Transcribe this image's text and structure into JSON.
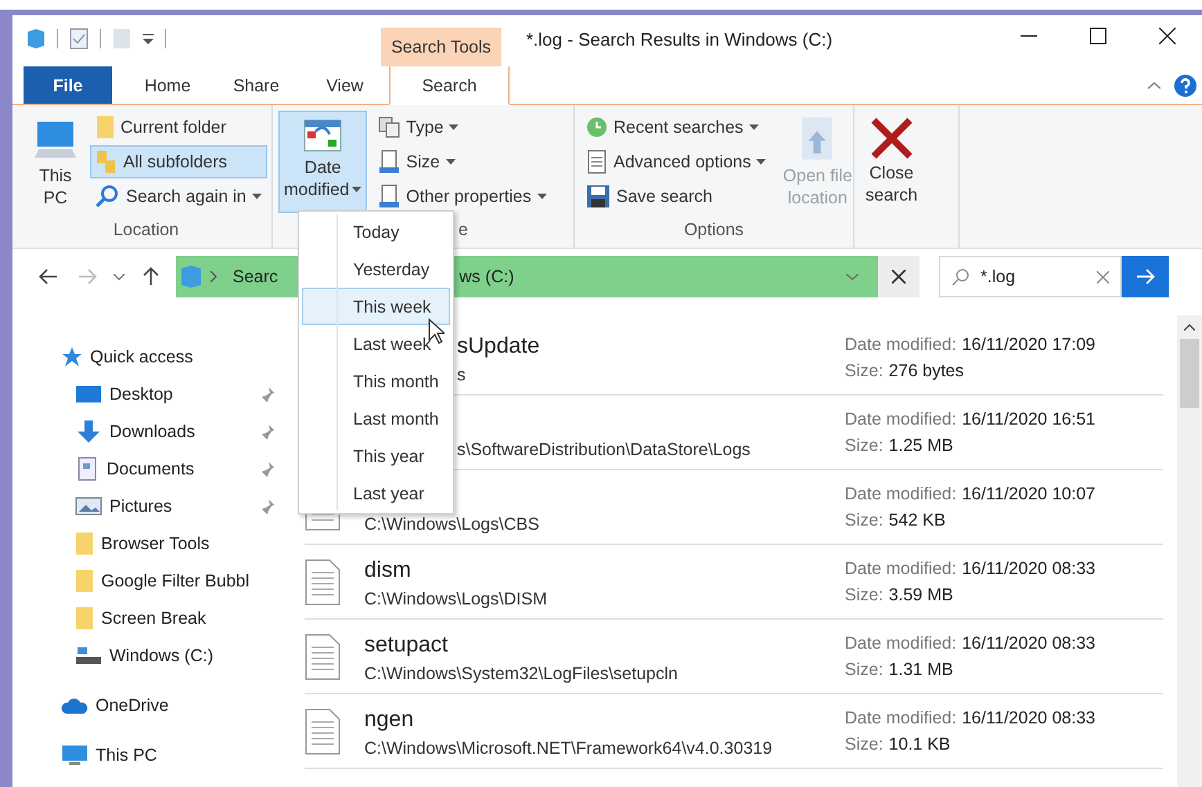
{
  "context_tab": {
    "label": "Search Tools"
  },
  "window": {
    "title": "*.log - Search Results in Windows (C:)"
  },
  "tabs": [
    {
      "label": "File",
      "kind": "file",
      "selected": false
    },
    {
      "label": "Home",
      "kind": "tab",
      "selected": false
    },
    {
      "label": "Share",
      "kind": "tab",
      "selected": false
    },
    {
      "label": "View",
      "kind": "tab",
      "selected": false
    },
    {
      "label": "Search",
      "kind": "tab",
      "selected": true
    }
  ],
  "ribbon": {
    "groups": [
      {
        "label": "Location",
        "items": [
          {
            "kind": "large",
            "lines": [
              "This",
              "PC"
            ],
            "menu": false,
            "highlighted": false,
            "disabled": false
          },
          {
            "kind": "small",
            "lines": [
              "Current folder"
            ],
            "menu": false,
            "highlighted": false,
            "disabled": false
          },
          {
            "kind": "small",
            "lines": [
              "All subfolders"
            ],
            "menu": false,
            "highlighted": true,
            "disabled": false
          },
          {
            "kind": "small",
            "lines": [
              "Search again in"
            ],
            "menu": true,
            "highlighted": false,
            "disabled": false
          }
        ]
      },
      {
        "label": "e",
        "cut": true,
        "items": [
          {
            "kind": "large",
            "lines": [
              "Date",
              "modified"
            ],
            "menu": true,
            "highlighted": true,
            "disabled": false
          },
          {
            "kind": "small",
            "lines": [
              "Type"
            ],
            "menu": true,
            "highlighted": false,
            "disabled": false
          },
          {
            "kind": "small",
            "lines": [
              "Size"
            ],
            "menu": true,
            "highlighted": false,
            "disabled": false
          },
          {
            "kind": "small",
            "lines": [
              "Other properties"
            ],
            "menu": true,
            "highlighted": false,
            "disabled": false
          }
        ]
      },
      {
        "label": "Options",
        "items": [
          {
            "kind": "small",
            "lines": [
              "Recent searches"
            ],
            "menu": true,
            "highlighted": false,
            "disabled": false
          },
          {
            "kind": "small",
            "lines": [
              "Advanced options"
            ],
            "menu": true,
            "highlighted": false,
            "disabled": false
          },
          {
            "kind": "small",
            "lines": [
              "Save search"
            ],
            "menu": false,
            "highlighted": false,
            "disabled": false
          },
          {
            "kind": "large",
            "lines": [
              "Open file",
              "location"
            ],
            "menu": false,
            "highlighted": false,
            "disabled": true
          }
        ]
      },
      {
        "items": [
          {
            "kind": "large",
            "lines": [
              "Close",
              "search"
            ],
            "menu": false,
            "highlighted": false,
            "disabled": false
          }
        ]
      }
    ]
  },
  "date_menu": {
    "items": [
      {
        "label": "Today",
        "selected": false
      },
      {
        "label": "Yesterday",
        "selected": false
      },
      {
        "label": "This week",
        "selected": true
      },
      {
        "label": "Last week",
        "selected": false
      },
      {
        "label": "This month",
        "selected": false
      },
      {
        "label": "Last month",
        "selected": false
      },
      {
        "label": "This year",
        "selected": false
      },
      {
        "label": "Last year",
        "selected": false
      }
    ]
  },
  "address": {
    "segments": [
      "Searc",
      "ws (C:)"
    ]
  },
  "search": {
    "value": "*.log"
  },
  "sidebar": {
    "items": [
      {
        "label": "Quick access",
        "pinned": false,
        "children": [
          {
            "label": "Desktop",
            "pinned": true
          },
          {
            "label": "Downloads",
            "pinned": true
          },
          {
            "label": "Documents",
            "pinned": true
          },
          {
            "label": "Pictures",
            "pinned": true
          },
          {
            "label": "Browser Tools",
            "pinned": false
          },
          {
            "label": "Google Filter Bubbl",
            "pinned": false
          },
          {
            "label": "Screen Break",
            "pinned": false
          },
          {
            "label": "Windows (C:)",
            "pinned": false
          }
        ]
      },
      {
        "label": "OneDrive",
        "pinned": false
      },
      {
        "label": "This PC",
        "pinned": false
      }
    ]
  },
  "results": [
    {
      "cut": true,
      "name": "sUpdate",
      "path": "s",
      "date_label": "Date modified:",
      "date": "16/11/2020 17:09",
      "size_label": "Size:",
      "size": "276 bytes"
    },
    {
      "cut": true,
      "path": "s\\SoftwareDistribution\\DataStore\\Logs",
      "date_label": "Date modified:",
      "date": "16/11/2020 16:51",
      "size_label": "Size:",
      "size": "1.25 MB"
    },
    {
      "cut": false,
      "path": "C:\\Windows\\Logs\\CBS",
      "date_label": "Date modified:",
      "date": "16/11/2020 10:07",
      "size_label": "Size:",
      "size": "542 KB"
    },
    {
      "cut": false,
      "name": "dism",
      "path": "C:\\Windows\\Logs\\DISM",
      "date_label": "Date modified:",
      "date": "16/11/2020 08:33",
      "size_label": "Size:",
      "size": "3.59 MB"
    },
    {
      "cut": false,
      "name": "setupact",
      "path": "C:\\Windows\\System32\\LogFiles\\setupcln",
      "date_label": "Date modified:",
      "date": "16/11/2020 08:33",
      "size_label": "Size:",
      "size": "1.31 MB"
    },
    {
      "cut": false,
      "name": "ngen",
      "path": "C:\\Windows\\Microsoft.NET\\Framework64\\v4.0.30319",
      "date_label": "Date modified:",
      "date": "16/11/2020 08:33",
      "size_label": "Size:",
      "size": "10.1 KB"
    }
  ]
}
